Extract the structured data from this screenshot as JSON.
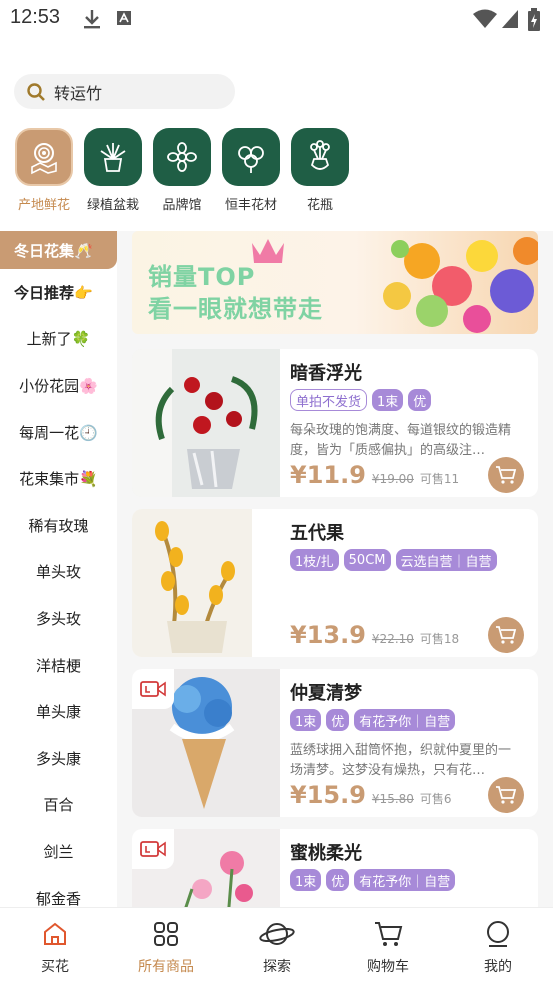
{
  "status_bar": {
    "time": "12:53"
  },
  "search": {
    "text": "转运竹"
  },
  "categories": [
    {
      "label": "产地鲜花",
      "icon": "fresh-flower-origin-icon",
      "active": true
    },
    {
      "label": "绿植盆栽",
      "icon": "potted-plant-icon"
    },
    {
      "label": "品牌馆",
      "icon": "brand-flower-icon"
    },
    {
      "label": "恒丰花材",
      "icon": "flower-material-icon"
    },
    {
      "label": "花瓶",
      "icon": "vase-icon"
    }
  ],
  "sidebar": {
    "header": "冬日花集🥂",
    "items": [
      "今日推荐👉",
      "上新了🍀",
      "小份花园🌸",
      "每周一花🕘",
      "花束集市💐",
      "稀有玫瑰",
      "单头玫",
      "多头玫",
      "洋桔梗",
      "单头康",
      "多头康",
      "百合",
      "剑兰",
      "郁金香"
    ]
  },
  "banner": {
    "line1": "销量TOP",
    "line2": "看一眼就想带走"
  },
  "products": [
    {
      "name": "暗香浮光",
      "tags": [
        {
          "text": "单拍不发货",
          "style": "outline"
        },
        {
          "text": "1束"
        },
        {
          "text": "优"
        }
      ],
      "desc": "每朵玫瑰的饱满度、每道银纹的锻造精度，皆为「质感偏执」的高级注…",
      "price": "¥11.9",
      "orig": "¥19.00",
      "stock": "可售11",
      "video": false
    },
    {
      "name": "五代果",
      "tags": [
        {
          "text": "1枝/扎"
        },
        {
          "text": "50CM"
        },
        {
          "text": "云选自营｜自营"
        }
      ],
      "desc": "",
      "price": "¥13.9",
      "orig": "¥22.10",
      "stock": "可售18",
      "video": false
    },
    {
      "name": "仲夏清梦",
      "tags": [
        {
          "text": "1束"
        },
        {
          "text": "优"
        },
        {
          "text": "有花予你｜自营"
        }
      ],
      "desc": "蓝绣球拥入甜筒怀抱，织就仲夏里的一场清梦。这梦没有燥热，只有花…",
      "price": "¥15.9",
      "orig": "¥15.80",
      "stock": "可售6",
      "video": true
    },
    {
      "name": "蜜桃柔光",
      "tags": [
        {
          "text": "1束"
        },
        {
          "text": "优"
        },
        {
          "text": "有花予你｜自营"
        }
      ],
      "desc": "",
      "price": "",
      "orig": "",
      "stock": "",
      "video": true
    }
  ],
  "bottom_nav": [
    {
      "label": "买花",
      "icon": "home-icon"
    },
    {
      "label": "所有商品",
      "icon": "grid-icon",
      "active": true
    },
    {
      "label": "探索",
      "icon": "planet-icon"
    },
    {
      "label": "购物车",
      "icon": "cart-icon"
    },
    {
      "label": "我的",
      "icon": "profile-icon"
    }
  ],
  "colors": {
    "accent": "#c99b73",
    "green": "#1f5e45",
    "tag_purple": "#a78ad8"
  }
}
